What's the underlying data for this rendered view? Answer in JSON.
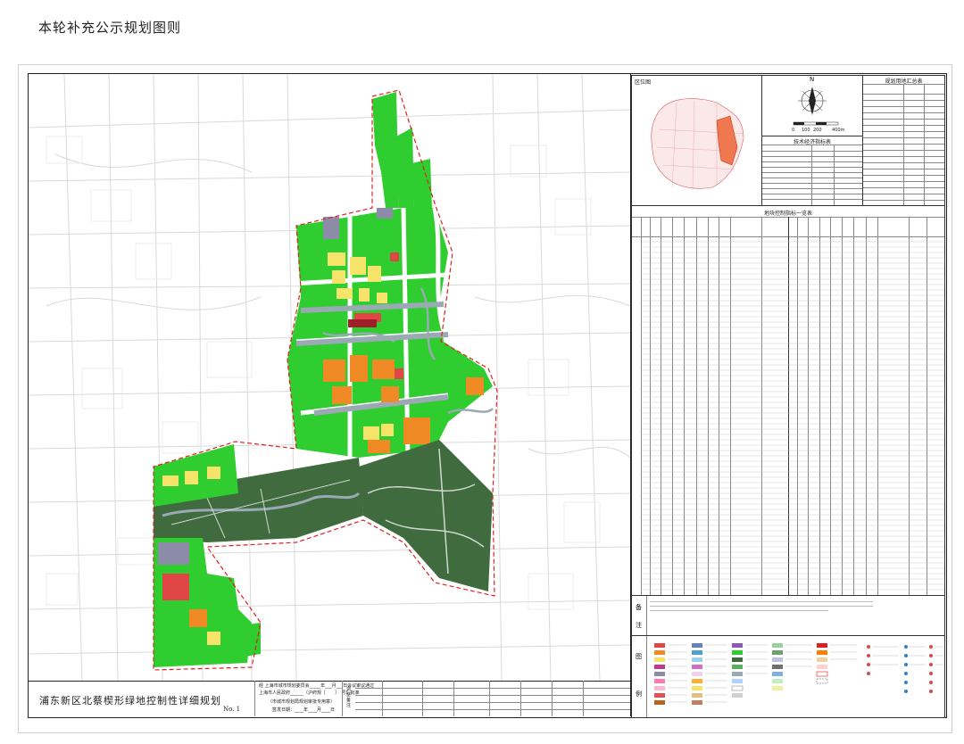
{
  "page": {
    "title": "本轮补充公示规划图则"
  },
  "map": {
    "colors": {
      "green": "#2fcd2f",
      "dark_green": "#3f6b3f",
      "road_white": "#ffffff",
      "water_gray": "#9aa9b3",
      "yellow": "#f5e36a",
      "orange": "#f08a24",
      "red": "#e04646",
      "purple": "#8c8ca8",
      "dark_red": "#a01e2a",
      "boundary_red": "#e02020"
    }
  },
  "right_panel": {
    "location_box_title": "区位图",
    "compass_label": "N",
    "scale_labels": [
      "0",
      "100",
      "200",
      "400m"
    ],
    "tech_table_title": "技术经济指标表",
    "land_table_title": "规划用地汇总表",
    "control_table_title": "地块控制指标一览表",
    "notes_label_1": "备",
    "notes_label_2": "注",
    "legend_label_1": "图",
    "legend_label_2": "例"
  },
  "title_block": {
    "plan_name": "浦东新区北蔡楔形绿地控制性详细规划",
    "plan_no": "No. 1",
    "approval_line_1": "经 上海市城市规划委员会_____年___月___日会议审议通过",
    "approval_line_2": "上海市人民政府______（沪府规［　　］　号）批准",
    "approval_line_3": "（市城市规划局规划审批专用章）",
    "approval_date": "签发日期：____年____月____日",
    "revision_label": "调整备注"
  }
}
